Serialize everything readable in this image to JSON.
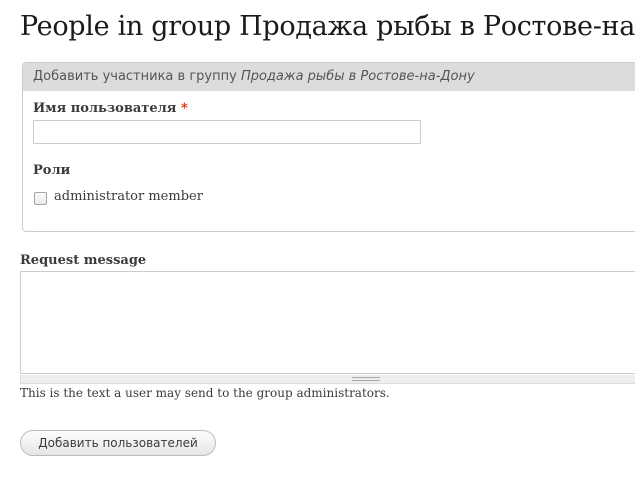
{
  "page": {
    "title": "People in group Продажа рыбы в Ростове-на-Дону"
  },
  "add_member": {
    "legend_prefix": "Добавить участника в группу",
    "legend_group": "Продажа рыбы в Ростове-на-Дону",
    "username_label": "Имя пользователя",
    "required_marker": "*",
    "username_value": "",
    "roles_label": "Роли",
    "role_option": "administrator member",
    "role_checked": false
  },
  "request": {
    "label": "Request message",
    "value": "",
    "description": "This is the text a user may send to the group administrators."
  },
  "actions": {
    "submit_label": "Добавить пользователей"
  }
}
